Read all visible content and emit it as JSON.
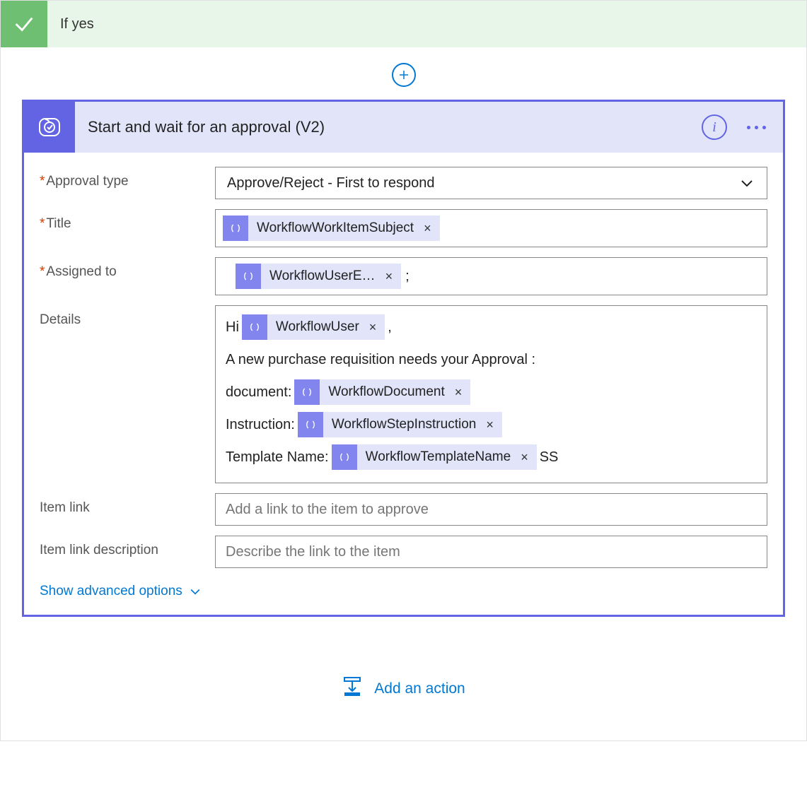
{
  "header": {
    "title": "If yes"
  },
  "action": {
    "title": "Start and wait for an approval (V2)",
    "fields": {
      "approval_type": {
        "label": "Approval type",
        "value": "Approve/Reject - First to respond"
      },
      "title": {
        "label": "Title",
        "tokens": [
          {
            "name": "WorkflowWorkItemSubject"
          }
        ]
      },
      "assigned_to": {
        "label": "Assigned to",
        "tokens": [
          {
            "name": "WorkflowUserE…"
          }
        ],
        "suffix": ";"
      },
      "details": {
        "label": "Details",
        "lines": [
          {
            "prefix": "Hi ",
            "token": "WorkflowUser",
            "suffix": ","
          },
          {
            "text": "A new purchase requisition needs your Approval :"
          },
          {
            "prefix": "document:",
            "token": "WorkflowDocument"
          },
          {
            "prefix": "Instruction:",
            "token": "WorkflowStepInstruction"
          },
          {
            "prefix": "Template Name:",
            "token": "WorkflowTemplateName",
            "suffix": " SS"
          }
        ]
      },
      "item_link": {
        "label": "Item link",
        "placeholder": "Add a link to the item to approve"
      },
      "item_link_desc": {
        "label": "Item link description",
        "placeholder": "Describe the link to the item"
      }
    },
    "advanced_label": "Show advanced options"
  },
  "footer": {
    "add_action": "Add an action"
  }
}
